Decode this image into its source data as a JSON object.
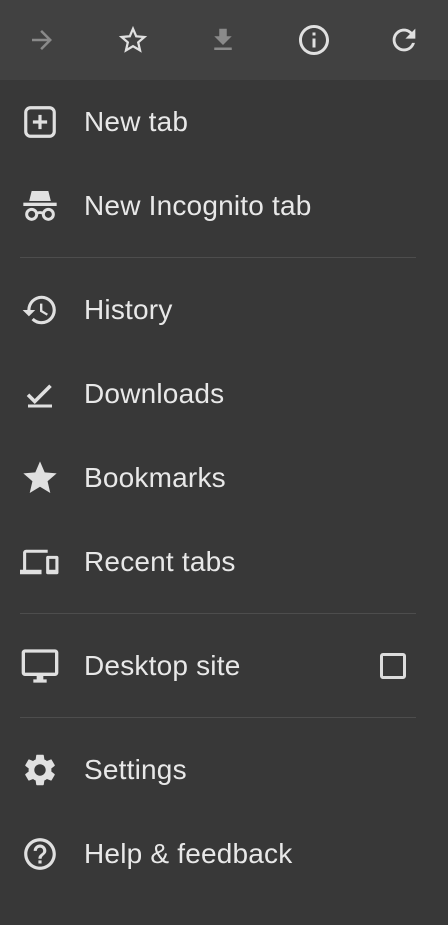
{
  "colors": {
    "background": "#383838",
    "topbar": "#414141",
    "text": "#e8e8e8",
    "icon": "#e0e0e0",
    "icon_disabled": "#8a8a8a",
    "divider": "#4d4d4d"
  },
  "toolbar": {
    "buttons": [
      {
        "icon": "forward-arrow-icon",
        "enabled": false
      },
      {
        "icon": "star-outline-icon",
        "enabled": true
      },
      {
        "icon": "download-icon",
        "enabled": false
      },
      {
        "icon": "info-icon",
        "enabled": true
      },
      {
        "icon": "reload-icon",
        "enabled": true
      }
    ]
  },
  "menu": {
    "new_tab": "New tab",
    "new_incognito_tab": "New Incognito tab",
    "history": "History",
    "downloads": "Downloads",
    "bookmarks": "Bookmarks",
    "recent_tabs": "Recent tabs",
    "desktop_site": "Desktop site",
    "desktop_site_checked": false,
    "settings": "Settings",
    "help_feedback": "Help & feedback"
  }
}
